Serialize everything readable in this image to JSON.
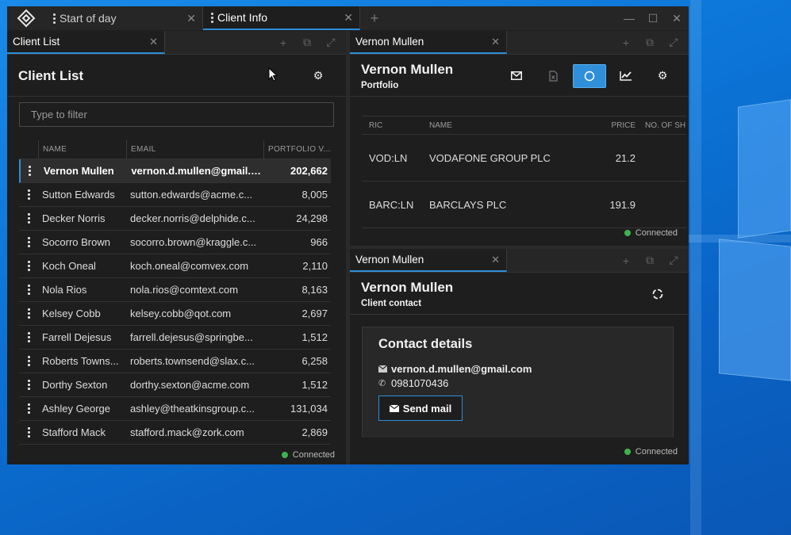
{
  "window": {
    "tabs": [
      {
        "label": "Start of day"
      },
      {
        "label": "Client Info"
      }
    ]
  },
  "client_list": {
    "tab_label": "Client List",
    "title": "Client List",
    "filter_placeholder": "Type to filter",
    "columns": [
      "NAME",
      "EMAIL",
      "PORTFOLIO V..."
    ],
    "rows": [
      {
        "name": "Vernon Mullen",
        "email": "vernon.d.mullen@gmail.c...",
        "value": "202,662"
      },
      {
        "name": "Sutton Edwards",
        "email": "sutton.edwards@acme.c...",
        "value": "8,005"
      },
      {
        "name": "Decker Norris",
        "email": "decker.norris@delphide.c...",
        "value": "24,298"
      },
      {
        "name": "Socorro Brown",
        "email": "socorro.brown@kraggle.c...",
        "value": "966"
      },
      {
        "name": "Koch Oneal",
        "email": "koch.oneal@comvex.com",
        "value": "2,110"
      },
      {
        "name": "Nola Rios",
        "email": "nola.rios@comtext.com",
        "value": "8,163"
      },
      {
        "name": "Kelsey Cobb",
        "email": "kelsey.cobb@qot.com",
        "value": "2,697"
      },
      {
        "name": "Farrell Dejesus",
        "email": "farrell.dejesus@springbe...",
        "value": "1,512"
      },
      {
        "name": "Roberts Towns...",
        "email": "roberts.townsend@slax.c...",
        "value": "6,258"
      },
      {
        "name": "Dorthy Sexton",
        "email": "dorthy.sexton@acme.com",
        "value": "1,512"
      },
      {
        "name": "Ashley George",
        "email": "ashley@theatkinsgroup.c...",
        "value": "131,034"
      },
      {
        "name": "Stafford Mack",
        "email": "stafford.mack@zork.com",
        "value": "2,869"
      }
    ],
    "status": "Connected"
  },
  "portfolio": {
    "tab_label": "Vernon Mullen",
    "title": "Vernon Mullen",
    "subtitle": "Portfolio",
    "columns": [
      "RIC",
      "NAME",
      "PRICE",
      "NO. OF SH"
    ],
    "rows": [
      {
        "ric": "VOD:LN",
        "name": "VODAFONE GROUP PLC",
        "price": "21.2"
      },
      {
        "ric": "BARC:LN",
        "name": "BARCLAYS PLC",
        "price": "191.9"
      }
    ],
    "status": "Connected"
  },
  "contact": {
    "tab_label": "Vernon Mullen",
    "title": "Vernon Mullen",
    "subtitle": "Client contact",
    "card_title": "Contact details",
    "email": "vernon.d.mullen@gmail.com",
    "phone": "0981070436",
    "send_label": "Send mail",
    "status": "Connected"
  },
  "colors": {
    "accent": "#2f8fd8",
    "connected": "#3fb24f",
    "background": "#1e1e1e"
  }
}
